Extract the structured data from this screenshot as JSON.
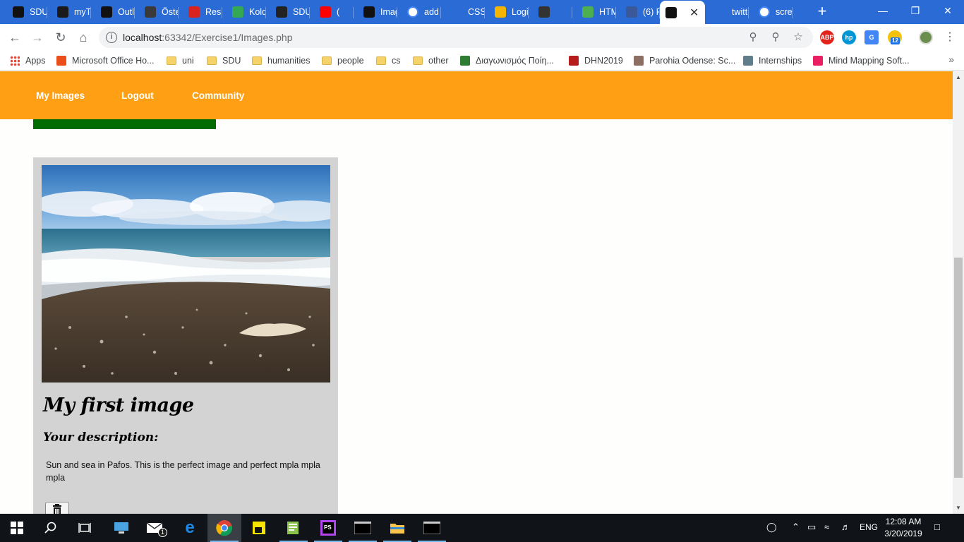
{
  "browser": {
    "tabs": [
      {
        "label": "SDU",
        "favicon": "sdu-logo-icon",
        "color": "#111111"
      },
      {
        "label": "myT",
        "favicon": "blackboard-icon",
        "color": "#1a1a1a"
      },
      {
        "label": "Outl",
        "favicon": "sdu-logo-icon",
        "color": "#111111"
      },
      {
        "label": "Öste",
        "favicon": "page-icon",
        "color": "#3a3a3a"
      },
      {
        "label": "Resu",
        "favicon": "dsb-icon",
        "color": "#d8231f"
      },
      {
        "label": "Kold",
        "favicon": "maps-icon",
        "color": "#34a853"
      },
      {
        "label": "SDU",
        "favicon": "github-icon",
        "color": "#222222"
      },
      {
        "label": "(",
        "favicon": "youtube-icon",
        "color": "#ff0000"
      },
      {
        "label": "Imag",
        "favicon": "phpstorm-icon",
        "color": "#111111"
      },
      {
        "label": "add",
        "favicon": "google-icon",
        "color": "#ffffff"
      },
      {
        "label": "CSS",
        "favicon": "stackoverflow-icon",
        "color": "#2a6bd6"
      },
      {
        "label": "Logi",
        "favicon": "blob-icon",
        "color": "#f4b400"
      },
      {
        "label": "",
        "favicon": "pen-icon",
        "color": "#333333"
      },
      {
        "label": "HTM",
        "favicon": "w3-icon",
        "color": "#4caf50"
      },
      {
        "label": "(6) F",
        "favicon": "facebook-icon",
        "color": "#3b5998"
      },
      {
        "label": "",
        "favicon": "phpstorm-icon",
        "color": "#111111"
      },
      {
        "label": "twitt",
        "favicon": "stackoverflow-icon",
        "color": "#2a6bd6"
      },
      {
        "label": "scre",
        "favicon": "google-icon",
        "color": "#ffffff"
      }
    ],
    "url_host": "localhost",
    "url_path": ":63342/Exercise1/Images.php",
    "bookmarks": [
      {
        "label": "Apps",
        "icon": "apps-grid-icon"
      },
      {
        "label": "Microsoft Office Ho...",
        "icon": "office-icon"
      },
      {
        "label": "uni",
        "icon": "folder-icon"
      },
      {
        "label": "SDU",
        "icon": "folder-icon"
      },
      {
        "label": "humanities",
        "icon": "folder-icon"
      },
      {
        "label": "people",
        "icon": "folder-icon"
      },
      {
        "label": "cs",
        "icon": "folder-icon"
      },
      {
        "label": "other",
        "icon": "folder-icon"
      },
      {
        "label": "Διαγωνισμός Ποίη...",
        "icon": "site-icon"
      },
      {
        "label": "DHN2019",
        "icon": "site-icon"
      },
      {
        "label": "Parohia Odense: Sc...",
        "icon": "site-icon"
      },
      {
        "label": "Internships",
        "icon": "site-icon"
      },
      {
        "label": "Mind Mapping Soft...",
        "icon": "site-icon"
      }
    ],
    "ext_badge": "12"
  },
  "page": {
    "nav": {
      "my_images": "My Images",
      "logout": "Logout",
      "community": "Community"
    },
    "card": {
      "title": "My first image",
      "subtitle": "Your description:",
      "description": "Sun and sea in Pafos. This is the perfect image and perfect mpla mpla mpla"
    }
  },
  "taskbar": {
    "time": "12:08 AM",
    "date": "3/20/2019",
    "lang": "ENG",
    "mail_badge": "1"
  }
}
